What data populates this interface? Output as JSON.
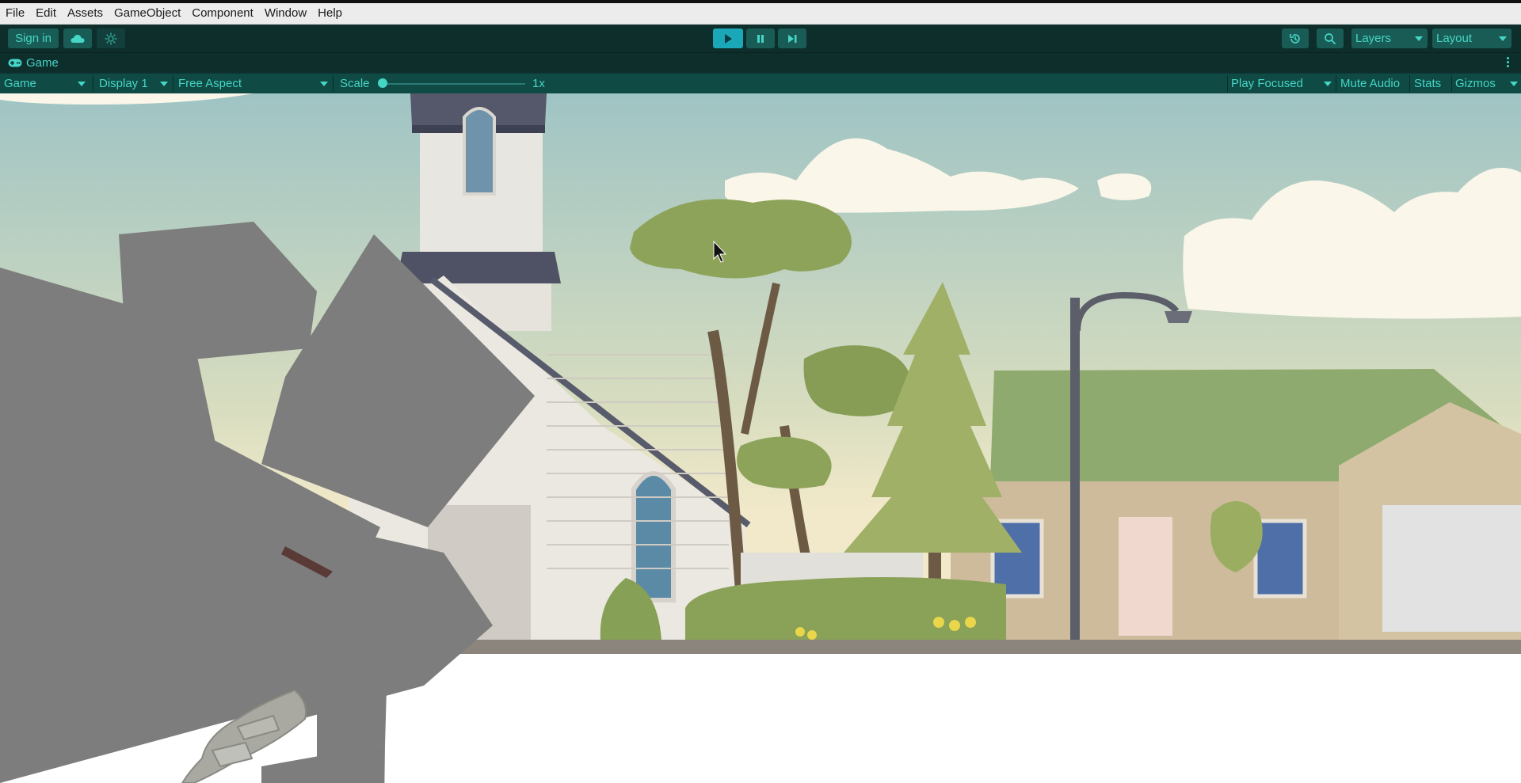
{
  "menubar": {
    "items": [
      "File",
      "Edit",
      "Assets",
      "GameObject",
      "Component",
      "Window",
      "Help"
    ]
  },
  "toolbar": {
    "sign_in_label": "Sign in",
    "cloud_icon": "cloud-icon",
    "collab_icon": "collab-icon",
    "play_icon": "play-icon",
    "pause_icon": "pause-icon",
    "step_icon": "step-icon",
    "history_icon": "history-icon",
    "search_icon": "search-icon",
    "layers_label": "Layers",
    "layout_label": "Layout",
    "play_active_color": "#1aa8b8"
  },
  "tab": {
    "icon": "gamepad-icon",
    "label": "Game"
  },
  "gamebar": {
    "view_select": "Game",
    "display_select": "Display 1",
    "aspect_select": "Free Aspect",
    "scale_label": "Scale",
    "scale_value": "1x",
    "play_focused_select": "Play Focused",
    "mute_audio_label": "Mute Audio",
    "stats_label": "Stats",
    "gizmos_label": "Gizmos"
  },
  "theme": {
    "accent": "#46d6c6",
    "toolbar_bg": "#0e2e2c",
    "control_bg": "#195c56",
    "gamebar_bg": "#0f4a44"
  },
  "scene": {
    "sky_color": "#a9c8c2",
    "ground_color": "#8c857e"
  }
}
